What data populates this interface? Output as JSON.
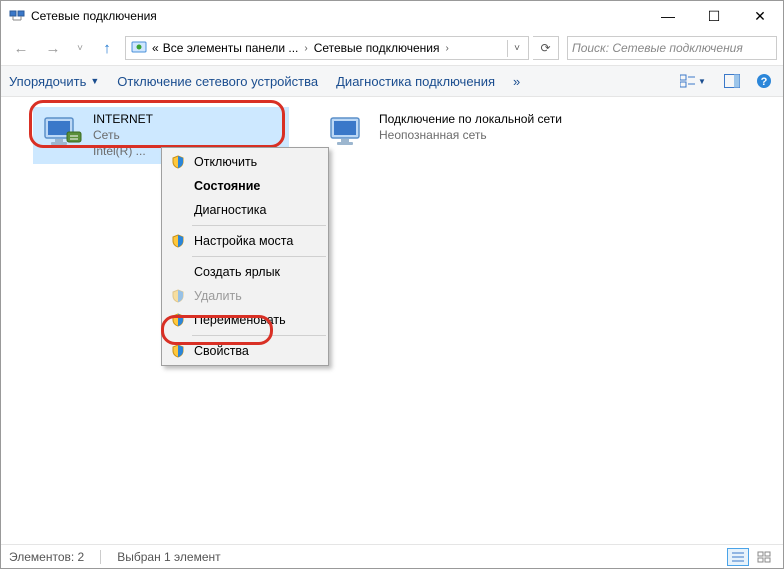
{
  "window": {
    "title": "Сетевые подключения",
    "minimize": "—",
    "maximize": "☐",
    "close": "✕"
  },
  "breadcrumb": {
    "prefix": "«",
    "seg1": "Все элементы панели ...",
    "seg2": "Сетевые подключения"
  },
  "search": {
    "placeholder": "Поиск: Сетевые подключения"
  },
  "toolbar": {
    "organize": "Упорядочить",
    "disable": "Отключение сетевого устройства",
    "diagnose": "Диагностика подключения",
    "more": "»"
  },
  "connections": [
    {
      "title": "INTERNET",
      "line2": "Сеть",
      "line3": "Intel(R) ..."
    },
    {
      "title": "Подключение по локальной сети",
      "line2": "Неопознанная сеть",
      "line3": ""
    }
  ],
  "contextMenu": {
    "items": [
      {
        "label": "Отключить",
        "shield": true,
        "bold": false
      },
      {
        "label": "Состояние",
        "shield": false,
        "bold": true
      },
      {
        "label": "Диагностика",
        "shield": false,
        "bold": false
      }
    ],
    "items2": [
      {
        "label": "Настройка моста",
        "shield": true
      }
    ],
    "items3": [
      {
        "label": "Создать ярлык",
        "shield": false,
        "disabled": false
      },
      {
        "label": "Удалить",
        "shield": true,
        "disabled": true
      },
      {
        "label": "Переименовать",
        "shield": true,
        "disabled": false
      }
    ],
    "items4": [
      {
        "label": "Свойства",
        "shield": true
      }
    ]
  },
  "statusbar": {
    "count": "Элементов: 2",
    "selected": "Выбран 1 элемент"
  }
}
